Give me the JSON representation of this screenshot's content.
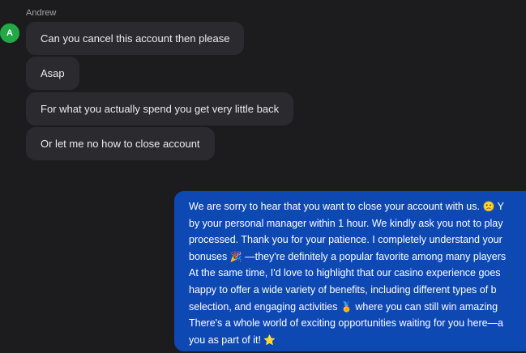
{
  "conversation": {
    "sender_name": "Andrew",
    "avatar_initial": "A",
    "avatar_color": "#22a845",
    "incoming_messages": [
      {
        "text": "Can you cancel this account then please"
      },
      {
        "text": "Asap"
      },
      {
        "text": "For what you actually spend you get very little back"
      },
      {
        "text": "Or let me no how to close account"
      }
    ],
    "outgoing_message": {
      "lines": [
        {
          "a": "We are sorry to hear that you want to close your account with us. ",
          "emoji": "🙁",
          "b": " Y"
        },
        {
          "a": "by your personal manager within 1 hour. We kindly ask you not to play",
          "emoji": "",
          "b": ""
        },
        {
          "a": "processed. Thank you for your patience. I completely understand your",
          "emoji": "",
          "b": ""
        },
        {
          "a": "bonuses ",
          "emoji": "🎉",
          "b": " —they're definitely a popular favorite among many players"
        },
        {
          "a": "At the same time, I'd love to highlight that our casino experience goes",
          "emoji": "",
          "b": ""
        },
        {
          "a": "happy to offer a wide variety of benefits, including different types of b",
          "emoji": "",
          "b": ""
        },
        {
          "a": "selection, and engaging activities ",
          "emoji": "🏅",
          "b": " where you can still win amazing"
        },
        {
          "a": "There's a whole world of exciting opportunities waiting for you here—a",
          "emoji": "",
          "b": ""
        },
        {
          "a": "you as part of it! ",
          "emoji": "⭐",
          "b": ""
        }
      ]
    }
  },
  "colors": {
    "background": "#1c1c1f",
    "incoming_bubble": "#2b2b2f",
    "outgoing_bubble": "#0e49b3"
  }
}
